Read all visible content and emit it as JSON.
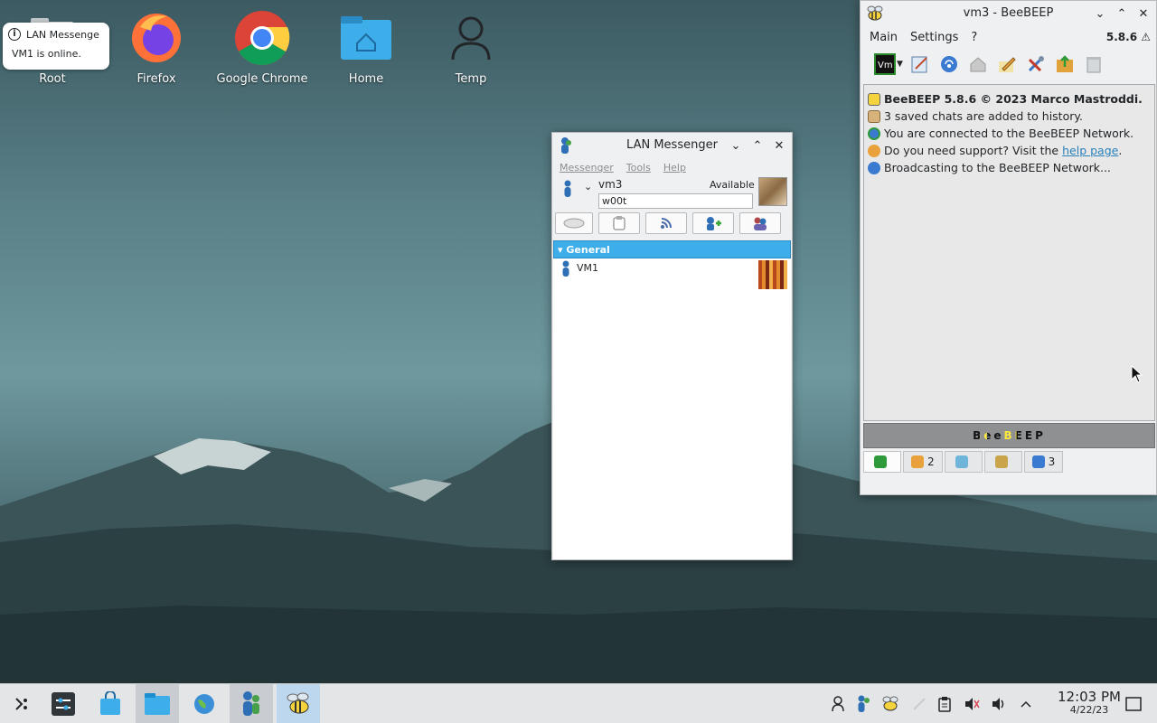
{
  "desktop": {
    "icons": [
      {
        "label": "Root"
      },
      {
        "label": "Firefox"
      },
      {
        "label": "Google Chrome"
      },
      {
        "label": "Home"
      },
      {
        "label": "Temp"
      }
    ]
  },
  "notification": {
    "title": "LAN Messenge",
    "body": "VM1 is online."
  },
  "lan_messenger": {
    "title": "LAN Messenger",
    "menu": [
      "Messenger",
      "Tools",
      "Help"
    ],
    "user_name": "vm3",
    "status": "Available",
    "note": "w00t",
    "group": "General",
    "contacts": [
      {
        "name": "VM1"
      }
    ]
  },
  "beebeep": {
    "title": "vm3 - BeeBEEP",
    "menu": [
      "Main",
      "Settings",
      "?"
    ],
    "version": "5.8.6",
    "log": [
      {
        "text": "BeeBEEP 5.8.6 © 2023 Marco Mastroddi."
      },
      {
        "text": "3 saved chats are added to history."
      },
      {
        "text": "You are connected to the BeeBEEP Network."
      },
      {
        "text_before": "Do you need support? Visit the ",
        "link": "help page",
        "text_after": "."
      },
      {
        "text": "Broadcasting to the BeeBEEP Network..."
      }
    ],
    "banner": "BeeBEEP",
    "tabs": [
      {
        "count": ""
      },
      {
        "count": "2"
      },
      {
        "count": ""
      },
      {
        "count": ""
      },
      {
        "count": "3"
      }
    ]
  },
  "taskbar": {
    "time": "12:03 PM",
    "date": "4/22/23"
  },
  "colors": {
    "accent": "#3daee9",
    "link": "#2980b9",
    "taskbar_bg": "#e3e5e7"
  }
}
